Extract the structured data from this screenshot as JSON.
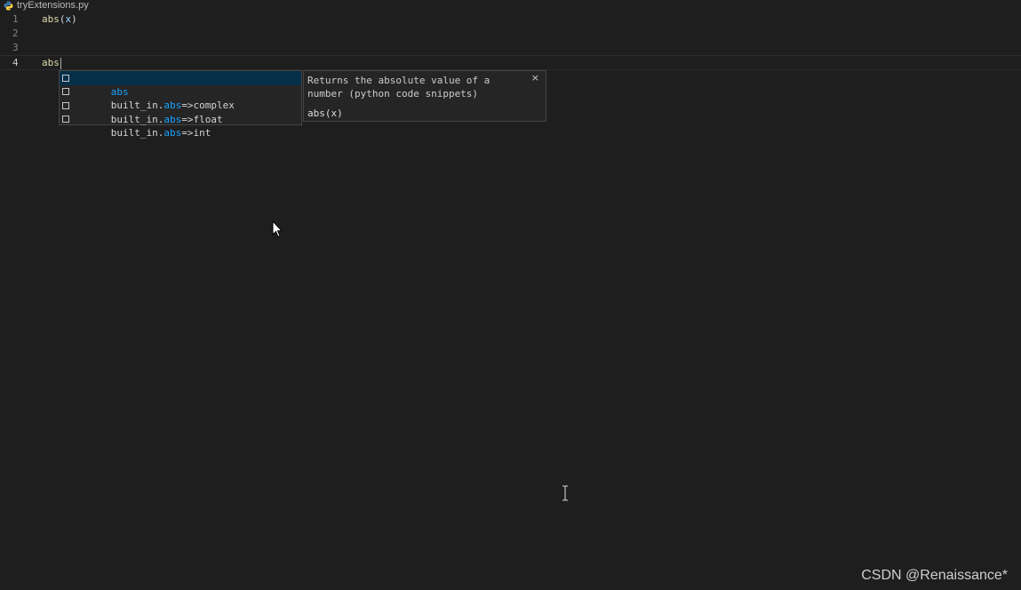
{
  "breadcrumb": {
    "file_name": "tryExtensions.py",
    "file_icon": "python-icon"
  },
  "editor": {
    "lines": [
      {
        "number": "1",
        "text": "abs(x)"
      },
      {
        "number": "2",
        "text": ""
      },
      {
        "number": "3",
        "text": ""
      },
      {
        "number": "4",
        "text": "abs"
      }
    ],
    "active_line": 4
  },
  "suggest": {
    "items": [
      {
        "prefix": "",
        "highlight": "abs",
        "suffix": ""
      },
      {
        "prefix": "built_in.",
        "highlight": "abs",
        "suffix": "=>complex"
      },
      {
        "prefix": "built_in.",
        "highlight": "abs",
        "suffix": "=>float"
      },
      {
        "prefix": "built_in.",
        "highlight": "abs",
        "suffix": "=>int"
      }
    ],
    "selected_index": 0,
    "item_icon": "snippet-icon"
  },
  "details": {
    "doc": "Returns the absolute value of a number (python code snippets)",
    "signature": "abs(x)",
    "close_label": "×"
  },
  "watermark": "CSDN @Renaissance*",
  "colors": {
    "background": "#1e1e1e",
    "widget_background": "#252526",
    "selection": "#062f4a",
    "match_highlight": "#18a3ff"
  }
}
